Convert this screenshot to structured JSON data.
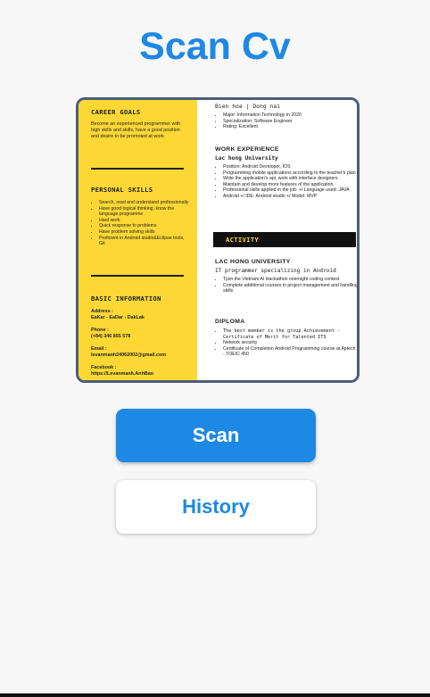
{
  "app": {
    "title": "Scan Cv"
  },
  "cv": {
    "left": {
      "career_goals": {
        "heading": "CAREER GOALS",
        "text": "Become an experienced programmer with high skills and skills, have a good position and desire to be promoted at work"
      },
      "personal_skills": {
        "heading": "PERSONAL SKILLS",
        "items": [
          "Search, read and understand professionally",
          "Have good logical thinking, know the language programme",
          "Hard work",
          "Quick response to problems",
          "Have problem solving skills",
          "Proficient in Android studio&Eclipse tools, Git"
        ]
      },
      "basic_information": {
        "heading": "BASIC INFORMATION",
        "address_label": "Address :",
        "address_value": "EaKar - EaDar - DakLak",
        "phone_label": "Phone :",
        "phone_value": "(+84) 346 855 578",
        "email_label": "Email :",
        "email_value": "levanmanh24062002@gmail.com",
        "facebook_label": "Facebook :",
        "facebook_value": "https://Levanmanh.AnhBao"
      }
    },
    "right": {
      "top_location": "Bien hoa | Dong nai",
      "top_items": [
        "Major: Information Technology in 2020",
        "Specialization: Software Engineer",
        "Rating: Excellent"
      ],
      "work_experience": {
        "heading": "WORK EXPERIENCE",
        "company": "Lac hong University",
        "items": [
          "Position: Android Developer, IOS",
          "Programming mobile applications according to the teacher's plan",
          "Write the application's api, work with interface designers.",
          "Maintain and develop more features of the application.",
          "Professional skills applied in the job: +/ Language used: JAVA",
          "Android +/ IDE: Android studio +/ Model: MVP"
        ]
      },
      "activity": {
        "heading": "ACTIVITY"
      },
      "lac_hong": {
        "heading": "LAC HONG UNIVERSITY",
        "subheading": "IT programmer specializing in Android",
        "items": [
          "Tjoin the Vietnam AI Hackathon overnight coding contest",
          "Complete additional courses in project management and handling skills"
        ]
      },
      "diploma": {
        "heading": "DIPLOMA",
        "items": [
          "The best member is the group Achievement - Certificate of Merit for Talented ITS",
          "Network security",
          "Certificate of Completion Android Programming course at Aptech - TOEIC 450"
        ]
      }
    }
  },
  "buttons": {
    "scan_label": "Scan",
    "history_label": "History"
  },
  "colors": {
    "accent": "#1e88e5",
    "cv_yellow": "#fdd835",
    "frame": "#4a5e78"
  }
}
